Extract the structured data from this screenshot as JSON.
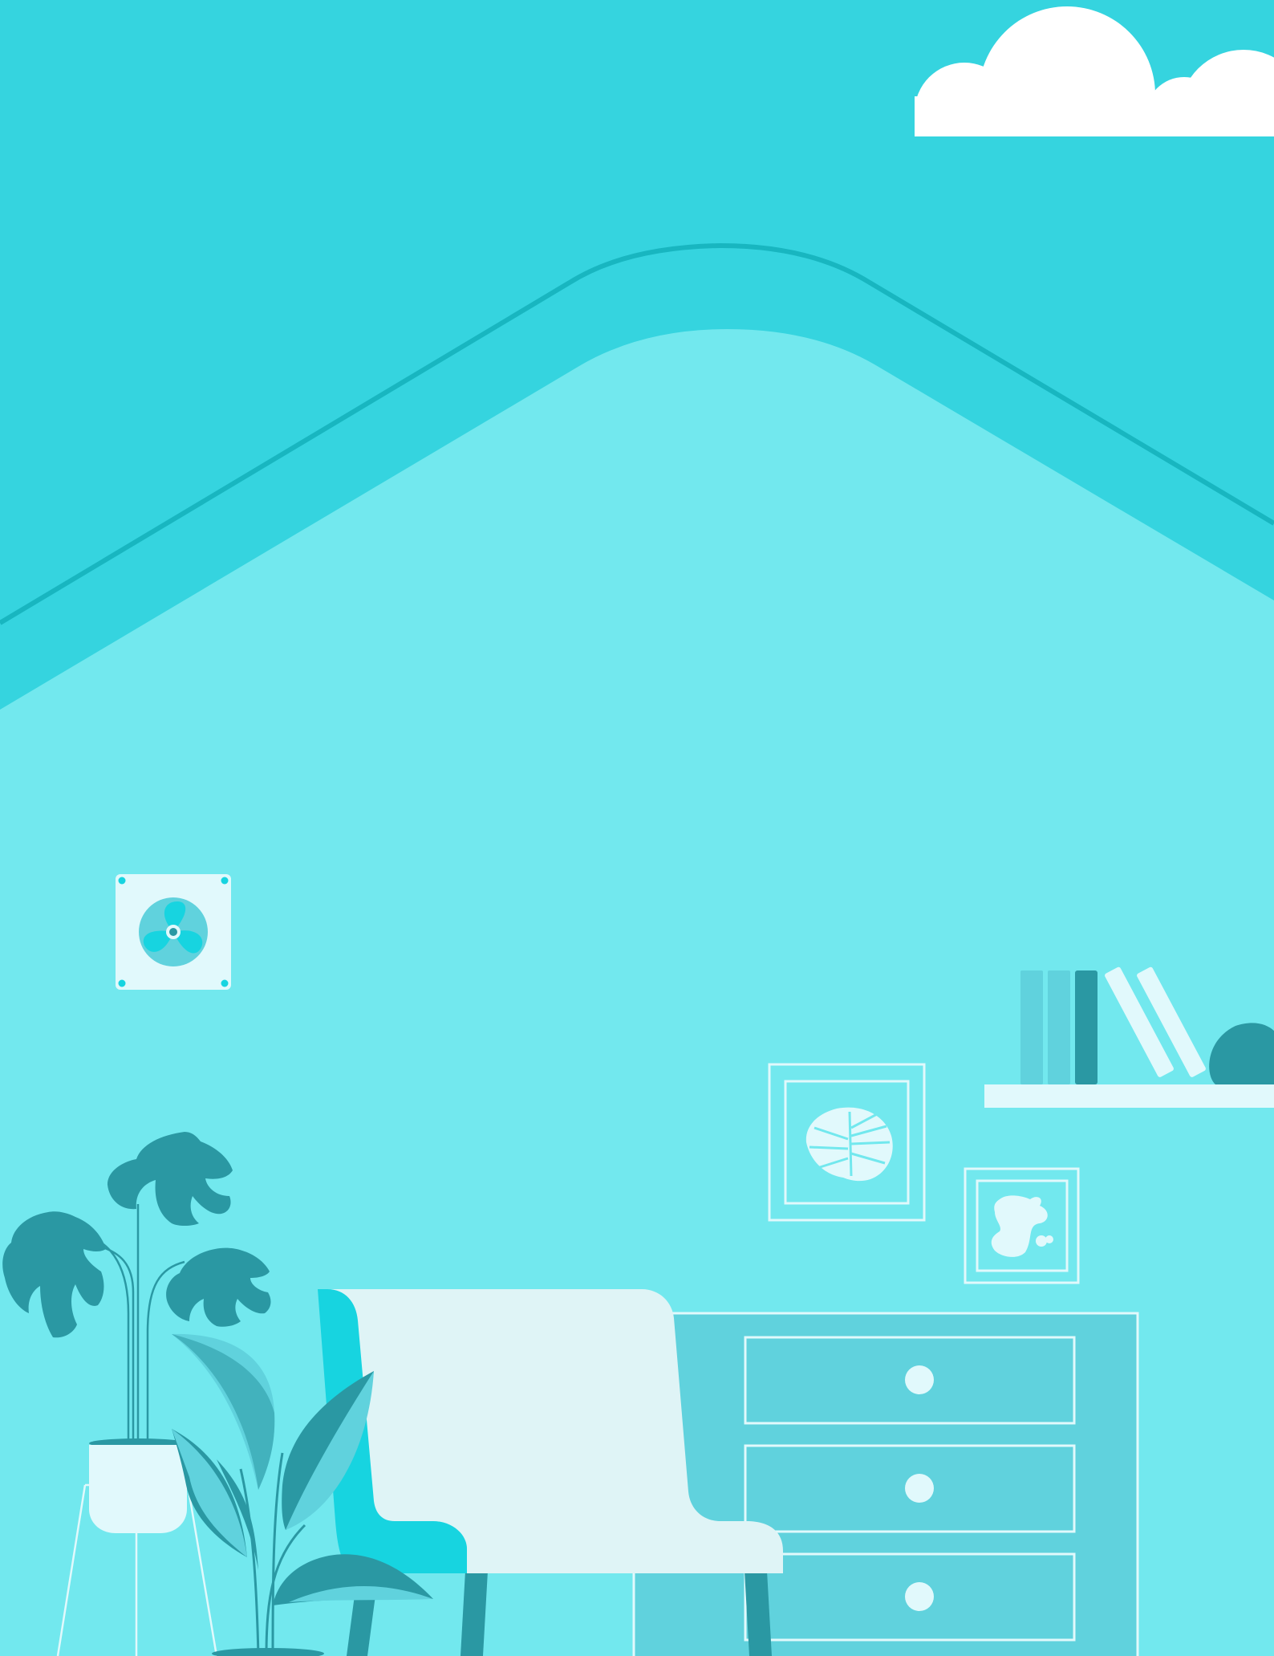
{
  "scene": {
    "type": "illustration",
    "subject": "interior-room",
    "colors": {
      "sky": "#35d4df",
      "ceiling_line": "#18b6c0",
      "wall": "#72e8ee",
      "dark_teal": "#2a98a3",
      "mid_teal": "#60d2dd",
      "bright_cyan": "#17d4e0",
      "white": "#ffffff",
      "pale": "#e1f9fc",
      "chair_body": "#dff4f6"
    },
    "icons": [
      "cloud-icon",
      "wall-fan-icon",
      "monstera-leaf-icon",
      "abstract-blob-icon",
      "book-icon",
      "vase-icon",
      "drawer-knob-icon"
    ],
    "objects": {
      "wall_fan": {
        "blades": 3
      },
      "bookshelf": {
        "books_upright": 3,
        "books_leaning": 2
      },
      "dresser": {
        "drawers": 3
      },
      "pictures": {
        "count": 2
      }
    }
  }
}
